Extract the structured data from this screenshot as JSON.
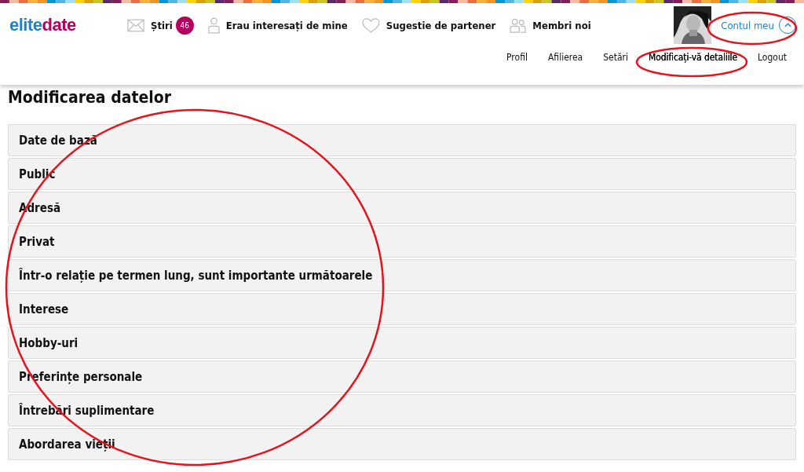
{
  "logo": {
    "part_1": "elite",
    "part_2": "date"
  },
  "nav": [
    {
      "kind": "mail",
      "label": "Știri",
      "badge": "46"
    },
    {
      "kind": "person",
      "label": "Erau interesați de mine"
    },
    {
      "kind": "heart",
      "label": "Sugestie de partener"
    },
    {
      "kind": "people",
      "label": "Membri noi"
    }
  ],
  "account": {
    "label": "Contul meu",
    "expanded": true
  },
  "subnav": [
    {
      "label": "Profil",
      "selected": false
    },
    {
      "label": "Afilierea",
      "selected": false
    },
    {
      "label": "Setări",
      "selected": false
    },
    {
      "label": "Modificați-vă detaliile",
      "selected": true
    },
    {
      "label": "Logout",
      "selected": false
    }
  ],
  "page_title": "Modificarea datelor",
  "sections": [
    "Date de bază",
    "Public",
    "Adresă",
    "Privat",
    "Într-o relație pe termen lung, sunt importante următoarele",
    "Interese",
    "Hobby-uri",
    "Preferințe personale",
    "Întrebări suplimentare",
    "Abordarea vieții"
  ]
}
